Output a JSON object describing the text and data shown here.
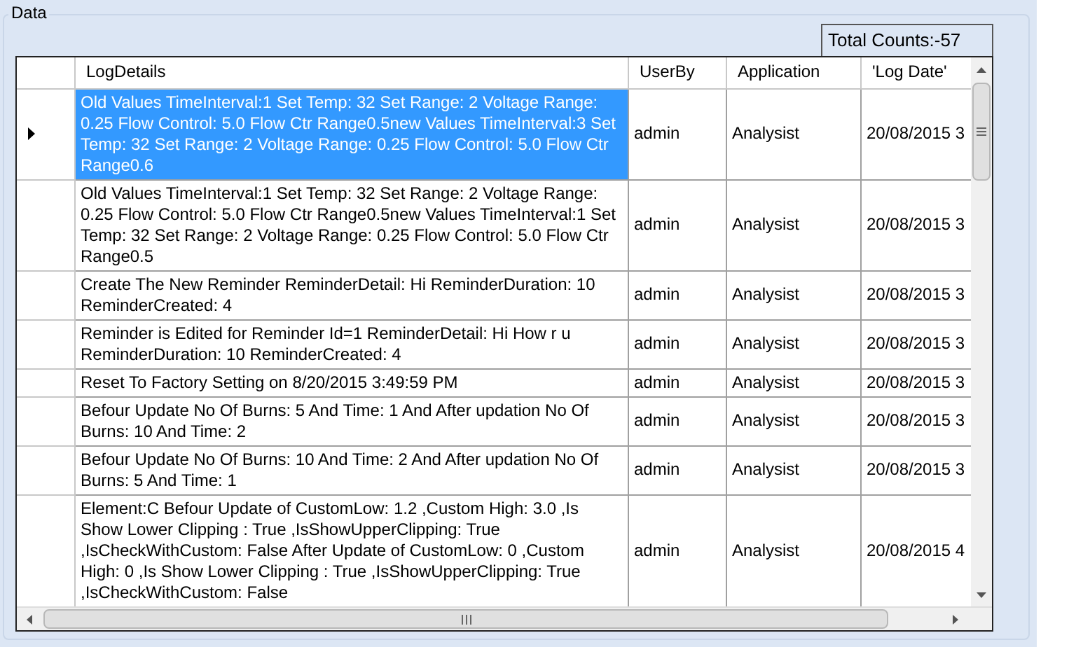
{
  "group_title": "Data",
  "total_counts": "Total Counts:-57",
  "table": {
    "columns": [
      "LogDetails",
      "UserBy",
      "Application",
      "'Log Date'"
    ],
    "rows": [
      {
        "selected": true,
        "log_details": "Old Values TimeInterval:1 Set Temp: 32 Set Range: 2 Voltage Range: 0.25 Flow Control: 5.0 Flow Ctr Range0.5new Values TimeInterval:3 Set Temp: 32 Set Range: 2 Voltage Range: 0.25 Flow Control: 5.0 Flow Ctr Range0.6",
        "user_by": "admin",
        "application": "Analysist",
        "log_date": "20/08/2015 3"
      },
      {
        "selected": false,
        "log_details": "Old Values TimeInterval:1 Set Temp: 32 Set Range: 2 Voltage Range: 0.25 Flow Control: 5.0 Flow Ctr Range0.5new Values TimeInterval:1 Set Temp: 32 Set Range: 2 Voltage Range: 0.25 Flow Control: 5.0 Flow Ctr Range0.5",
        "user_by": "admin",
        "application": "Analysist",
        "log_date": "20/08/2015 3"
      },
      {
        "selected": false,
        "log_details": "Create The New Reminder ReminderDetail: Hi ReminderDuration: 10 ReminderCreated: 4",
        "user_by": "admin",
        "application": "Analysist",
        "log_date": "20/08/2015 3"
      },
      {
        "selected": false,
        "log_details": "Reminder is Edited for Reminder Id=1 ReminderDetail: Hi How r u ReminderDuration: 10 ReminderCreated: 4",
        "user_by": "admin",
        "application": "Analysist",
        "log_date": "20/08/2015 3"
      },
      {
        "selected": false,
        "log_details": "Reset To Factory Setting on 8/20/2015 3:49:59 PM",
        "user_by": "admin",
        "application": "Analysist",
        "log_date": "20/08/2015 3"
      },
      {
        "selected": false,
        "log_details": "Befour Update No Of Burns: 5 And Time: 1 And After updation No Of Burns: 10 And Time: 2",
        "user_by": "admin",
        "application": "Analysist",
        "log_date": "20/08/2015 3"
      },
      {
        "selected": false,
        "log_details": "Befour Update No Of Burns: 10 And Time: 2 And After updation No Of Burns: 5 And Time: 1",
        "user_by": "admin",
        "application": "Analysist",
        "log_date": "20/08/2015 3"
      },
      {
        "selected": false,
        "log_details": "Element:C Befour Update of CustomLow: 1.2 ,Custom High: 3.0 ,Is Show Lower Clipping : True ,IsShowUpperClipping: True ,IsCheckWithCustom: False After Update of CustomLow: 0 ,Custom High: 0 ,Is Show Lower Clipping : True ,IsShowUpperClipping: True ,IsCheckWithCustom: False",
        "user_by": "admin",
        "application": "Analysist",
        "log_date": "20/08/2015 4"
      }
    ]
  }
}
